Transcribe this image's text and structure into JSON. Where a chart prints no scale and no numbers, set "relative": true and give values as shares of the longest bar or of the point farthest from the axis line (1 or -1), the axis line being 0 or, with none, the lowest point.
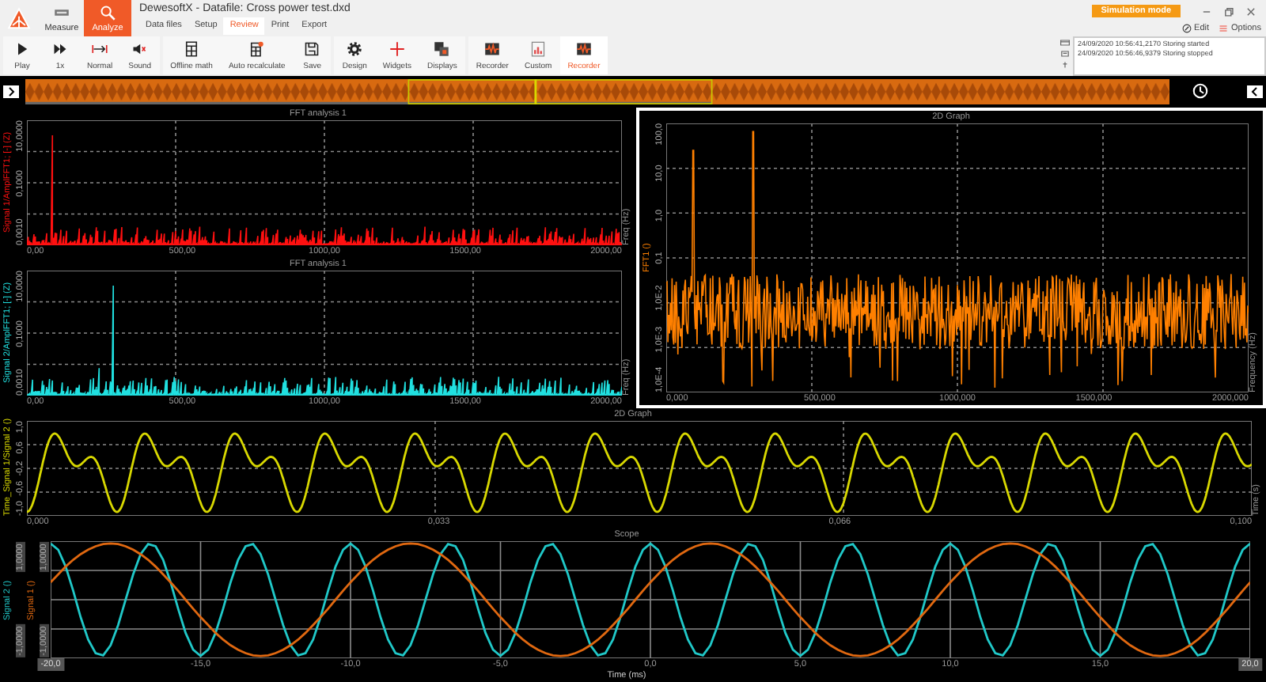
{
  "app": {
    "title": "DewesoftX - Datafile: Cross power test.dxd",
    "mode_badge": "Simulation mode"
  },
  "main_tabs": [
    {
      "label": "Measure",
      "selected": false
    },
    {
      "label": "Analyze",
      "selected": true
    }
  ],
  "sub_tabs": [
    {
      "label": "Data files",
      "selected": false
    },
    {
      "label": "Setup",
      "selected": false
    },
    {
      "label": "Review",
      "selected": true
    },
    {
      "label": "Print",
      "selected": false
    },
    {
      "label": "Export",
      "selected": false
    }
  ],
  "toolbar": [
    {
      "items": [
        {
          "label": "Play",
          "selected": false
        },
        {
          "label": "1x",
          "selected": false
        },
        {
          "label": "Normal",
          "selected": false
        },
        {
          "label": "Sound",
          "selected": false
        }
      ]
    },
    {
      "items": [
        {
          "label": "Offline math",
          "selected": false
        },
        {
          "label": "Auto recalculate",
          "selected": false
        },
        {
          "label": "Save",
          "selected": false
        }
      ]
    },
    {
      "items": [
        {
          "label": "Design",
          "selected": false
        },
        {
          "label": "Widgets",
          "selected": false
        },
        {
          "label": "Displays",
          "selected": false
        }
      ]
    },
    {
      "items": [
        {
          "label": "Recorder",
          "selected": false
        },
        {
          "label": "Custom",
          "selected": false
        },
        {
          "label": "Recorder",
          "selected": true
        }
      ]
    }
  ],
  "header_actions": [
    {
      "label": "Edit"
    },
    {
      "label": "Options"
    }
  ],
  "log": [
    "24/09/2020 10:56:41,2170 Storing started",
    "24/09/2020 10:56:46,9379 Storing stopped"
  ],
  "plots": [
    {
      "kind": "spectrum",
      "title": "FFT analysis 1",
      "selected": false,
      "xlabel": "Freq (Hz)",
      "xticks": [
        "0,00",
        "500,00",
        "1000,00",
        "1500,00",
        "2000,00"
      ],
      "axes": [
        {
          "label": "Signal 1/AmplFFT1; [-] (Z)",
          "color": "#ff1010",
          "ticks": [
            "10,0000",
            "0,1000",
            "0,0010"
          ]
        }
      ]
    },
    {
      "kind": "spectrum",
      "title": "FFT analysis 1",
      "selected": false,
      "xlabel": "Freq (Hz)",
      "xticks": [
        "0,00",
        "500,00",
        "1000,00",
        "1500,00",
        "2000,00"
      ],
      "axes": [
        {
          "label": "Signal 2/AmplFFT1; [-] (Z)",
          "color": "#20e0e0",
          "ticks": [
            "10,0000",
            "0,1000",
            "0,0010"
          ]
        }
      ]
    },
    {
      "kind": "logspectrum",
      "title": "2D Graph",
      "selected": true,
      "xlabel": "Frequency (Hz)",
      "xticks": [
        "0,000",
        "500,000",
        "1000,000",
        "1500,000",
        "2000,000"
      ],
      "axes": [
        {
          "label": "FFT1 ()",
          "color": "#ff8000",
          "ticks": [
            "100,0",
            "10,0",
            "1,0",
            "0,1",
            "1,0E-2",
            "1,0E-3",
            "1,0E-4"
          ]
        }
      ]
    },
    {
      "kind": "wave",
      "title": "2D Graph",
      "selected": false,
      "xlabel": "Time (s)",
      "xticks": [
        "0,000",
        "0,033",
        "0,066",
        "0,100"
      ],
      "axes": [
        {
          "label": "Time_Signal 1/Signal 2 ()",
          "color": "#d8d800",
          "ticks": [
            "1,0",
            "0,6",
            "-0,2",
            "-0,6",
            "-1,0"
          ]
        }
      ]
    },
    {
      "kind": "scope",
      "selected": false,
      "axis_ticks": [
        [
          "1,0000",
          "-1,0000"
        ],
        [
          "1,0000",
          "-1,0000"
        ]
      ],
      "chart_data": {
        "type": "line",
        "title": "Scope",
        "xlabel": "Time (ms)",
        "xlim": [
          -20,
          20
        ],
        "relative": true,
        "grid": true,
        "xticks": [
          {
            "value": -20,
            "label": "-20,0"
          },
          {
            "value": -15,
            "label": "-15,0"
          },
          {
            "value": -10,
            "label": "-10,0"
          },
          {
            "value": -5,
            "label": "-5,0"
          },
          {
            "value": 0,
            "label": "0,0"
          },
          {
            "value": 5,
            "label": "5,0"
          },
          {
            "value": 10,
            "label": "10,0"
          },
          {
            "value": 15,
            "label": "15,0"
          },
          {
            "value": 20,
            "label": "20,0"
          }
        ],
        "x": [
          -20,
          -19.75,
          -19.5,
          -19.25,
          -19,
          -18.75,
          -18.5,
          -18.25,
          -18,
          -17.75,
          -17.5,
          -17.25,
          -17,
          -16.75,
          -16.5,
          -16.25,
          -16,
          -15.75,
          -15.5,
          -15.25,
          -15,
          -14.75,
          -14.5,
          -14.25,
          -14,
          -13.75,
          -13.5,
          -13.25,
          -13,
          -12.75,
          -12.5,
          -12.25,
          -12,
          -11.75,
          -11.5,
          -11.25,
          -11,
          -10.75,
          -10.5,
          -10.25,
          -10,
          -9.75,
          -9.5,
          -9.25,
          -9,
          -8.75,
          -8.5,
          -8.25,
          -8,
          -7.75,
          -7.5,
          -7.25,
          -7,
          -6.75,
          -6.5,
          -6.25,
          -6,
          -5.75,
          -5.5,
          -5.25,
          -5,
          -4.75,
          -4.5,
          -4.25,
          -4,
          -3.75,
          -3.5,
          -3.25,
          -3,
          -2.75,
          -2.5,
          -2.25,
          -2,
          -1.75,
          -1.5,
          -1.25,
          -1,
          -0.75,
          -0.5,
          -0.25,
          0,
          0.25,
          0.5,
          0.75,
          1,
          1.25,
          1.5,
          1.75,
          2,
          2.25,
          2.5,
          2.75,
          3,
          3.25,
          3.5,
          3.75,
          4,
          4.25,
          4.5,
          4.75,
          5,
          5.25,
          5.5,
          5.75,
          6,
          6.25,
          6.5,
          6.75,
          7,
          7.25,
          7.5,
          7.75,
          8,
          8.25,
          8.5,
          8.75,
          9,
          9.25,
          9.5,
          9.75,
          10,
          10.25,
          10.5,
          10.75,
          11,
          11.25,
          11.5,
          11.75,
          12,
          12.25,
          12.5,
          12.75,
          13,
          13.25,
          13.5,
          13.75,
          14,
          14.25,
          14.5,
          14.75,
          15,
          15.25,
          15.5,
          15.75,
          16,
          16.25,
          16.5,
          16.75,
          17,
          17.25,
          17.5,
          17.75,
          18,
          18.25,
          18.5,
          18.75,
          19,
          19.25,
          19.5,
          19.75,
          20
        ],
        "series": [
          {
            "name": "Signal 2 ()",
            "color": "#20c8c8",
            "values": [
              1,
              0.89,
              0.59,
              0.16,
              -0.31,
              -0.71,
              -0.95,
              -0.99,
              -0.81,
              -0.45,
              0,
              0.45,
              0.81,
              0.99,
              0.95,
              0.71,
              0.31,
              -0.16,
              -0.59,
              -0.89,
              -1,
              -0.89,
              -0.59,
              -0.16,
              0.31,
              0.71,
              0.95,
              0.99,
              0.81,
              0.45,
              0,
              -0.45,
              -0.81,
              -0.99,
              -0.95,
              -0.71,
              -0.31,
              0.16,
              0.59,
              0.89,
              1,
              0.89,
              0.59,
              0.16,
              -0.31,
              -0.71,
              -0.95,
              -0.99,
              -0.81,
              -0.45,
              0,
              0.45,
              0.81,
              0.99,
              0.95,
              0.71,
              0.31,
              -0.16,
              -0.59,
              -0.89,
              -1,
              -0.89,
              -0.59,
              -0.16,
              0.31,
              0.71,
              0.95,
              0.99,
              0.81,
              0.45,
              0,
              -0.45,
              -0.81,
              -0.99,
              -0.95,
              -0.71,
              -0.31,
              0.16,
              0.59,
              0.89,
              1,
              0.89,
              0.59,
              0.16,
              -0.31,
              -0.71,
              -0.95,
              -0.99,
              -0.81,
              -0.45,
              0,
              0.45,
              0.81,
              0.99,
              0.95,
              0.71,
              0.31,
              -0.16,
              -0.59,
              -0.89,
              -1,
              -0.89,
              -0.59,
              -0.16,
              0.31,
              0.71,
              0.95,
              0.99,
              0.81,
              0.45,
              0,
              -0.45,
              -0.81,
              -0.99,
              -0.95,
              -0.71,
              -0.31,
              0.16,
              0.59,
              0.89,
              1,
              0.89,
              0.59,
              0.16,
              -0.31,
              -0.71,
              -0.95,
              -0.99,
              -0.81,
              -0.45,
              0,
              0.45,
              0.81,
              0.99,
              0.95,
              0.71,
              0.31,
              -0.16,
              -0.59,
              -0.89,
              -1,
              -0.89,
              -0.59,
              -0.16,
              0.31,
              0.71,
              0.95,
              0.99,
              0.81,
              0.45,
              0,
              -0.45,
              -0.81,
              -0.99,
              -0.95,
              -0.71,
              -0.31,
              0.16,
              0.59,
              0.89,
              1
            ]
          },
          {
            "name": "Signal 1 ()",
            "color": "#e06810",
            "values": [
              0.31,
              0.45,
              0.59,
              0.71,
              0.81,
              0.89,
              0.95,
              0.99,
              1,
              0.99,
              0.95,
              0.89,
              0.81,
              0.71,
              0.59,
              0.45,
              0.31,
              0.16,
              0,
              -0.16,
              -0.31,
              -0.45,
              -0.59,
              -0.71,
              -0.81,
              -0.89,
              -0.95,
              -0.99,
              -1,
              -0.99,
              -0.95,
              -0.89,
              -0.81,
              -0.71,
              -0.59,
              -0.45,
              -0.31,
              -0.16,
              0,
              0.16,
              0.31,
              0.45,
              0.59,
              0.71,
              0.81,
              0.89,
              0.95,
              0.99,
              1,
              0.99,
              0.95,
              0.89,
              0.81,
              0.71,
              0.59,
              0.45,
              0.31,
              0.16,
              0,
              -0.16,
              -0.31,
              -0.45,
              -0.59,
              -0.71,
              -0.81,
              -0.89,
              -0.95,
              -0.99,
              -1,
              -0.99,
              -0.95,
              -0.89,
              -0.81,
              -0.71,
              -0.59,
              -0.45,
              -0.31,
              -0.16,
              0,
              0.16,
              0.31,
              0.45,
              0.59,
              0.71,
              0.81,
              0.89,
              0.95,
              0.99,
              1,
              0.99,
              0.95,
              0.89,
              0.81,
              0.71,
              0.59,
              0.45,
              0.31,
              0.16,
              0,
              -0.16,
              -0.31,
              -0.45,
              -0.59,
              -0.71,
              -0.81,
              -0.89,
              -0.95,
              -0.99,
              -1,
              -0.99,
              -0.95,
              -0.89,
              -0.81,
              -0.71,
              -0.59,
              -0.45,
              -0.31,
              -0.16,
              0,
              0.16,
              0.31,
              0.45,
              0.59,
              0.71,
              0.81,
              0.89,
              0.95,
              0.99,
              1,
              0.99,
              0.95,
              0.89,
              0.81,
              0.71,
              0.59,
              0.45,
              0.31,
              0.16,
              0,
              -0.16,
              -0.31,
              -0.45,
              -0.59,
              -0.71,
              -0.81,
              -0.89,
              -0.95,
              -0.99,
              -1,
              -0.99,
              -0.95,
              -0.89,
              -0.81,
              -0.71,
              -0.59,
              -0.45,
              -0.31,
              -0.16,
              0,
              0.16,
              0.31
            ]
          }
        ]
      }
    }
  ]
}
